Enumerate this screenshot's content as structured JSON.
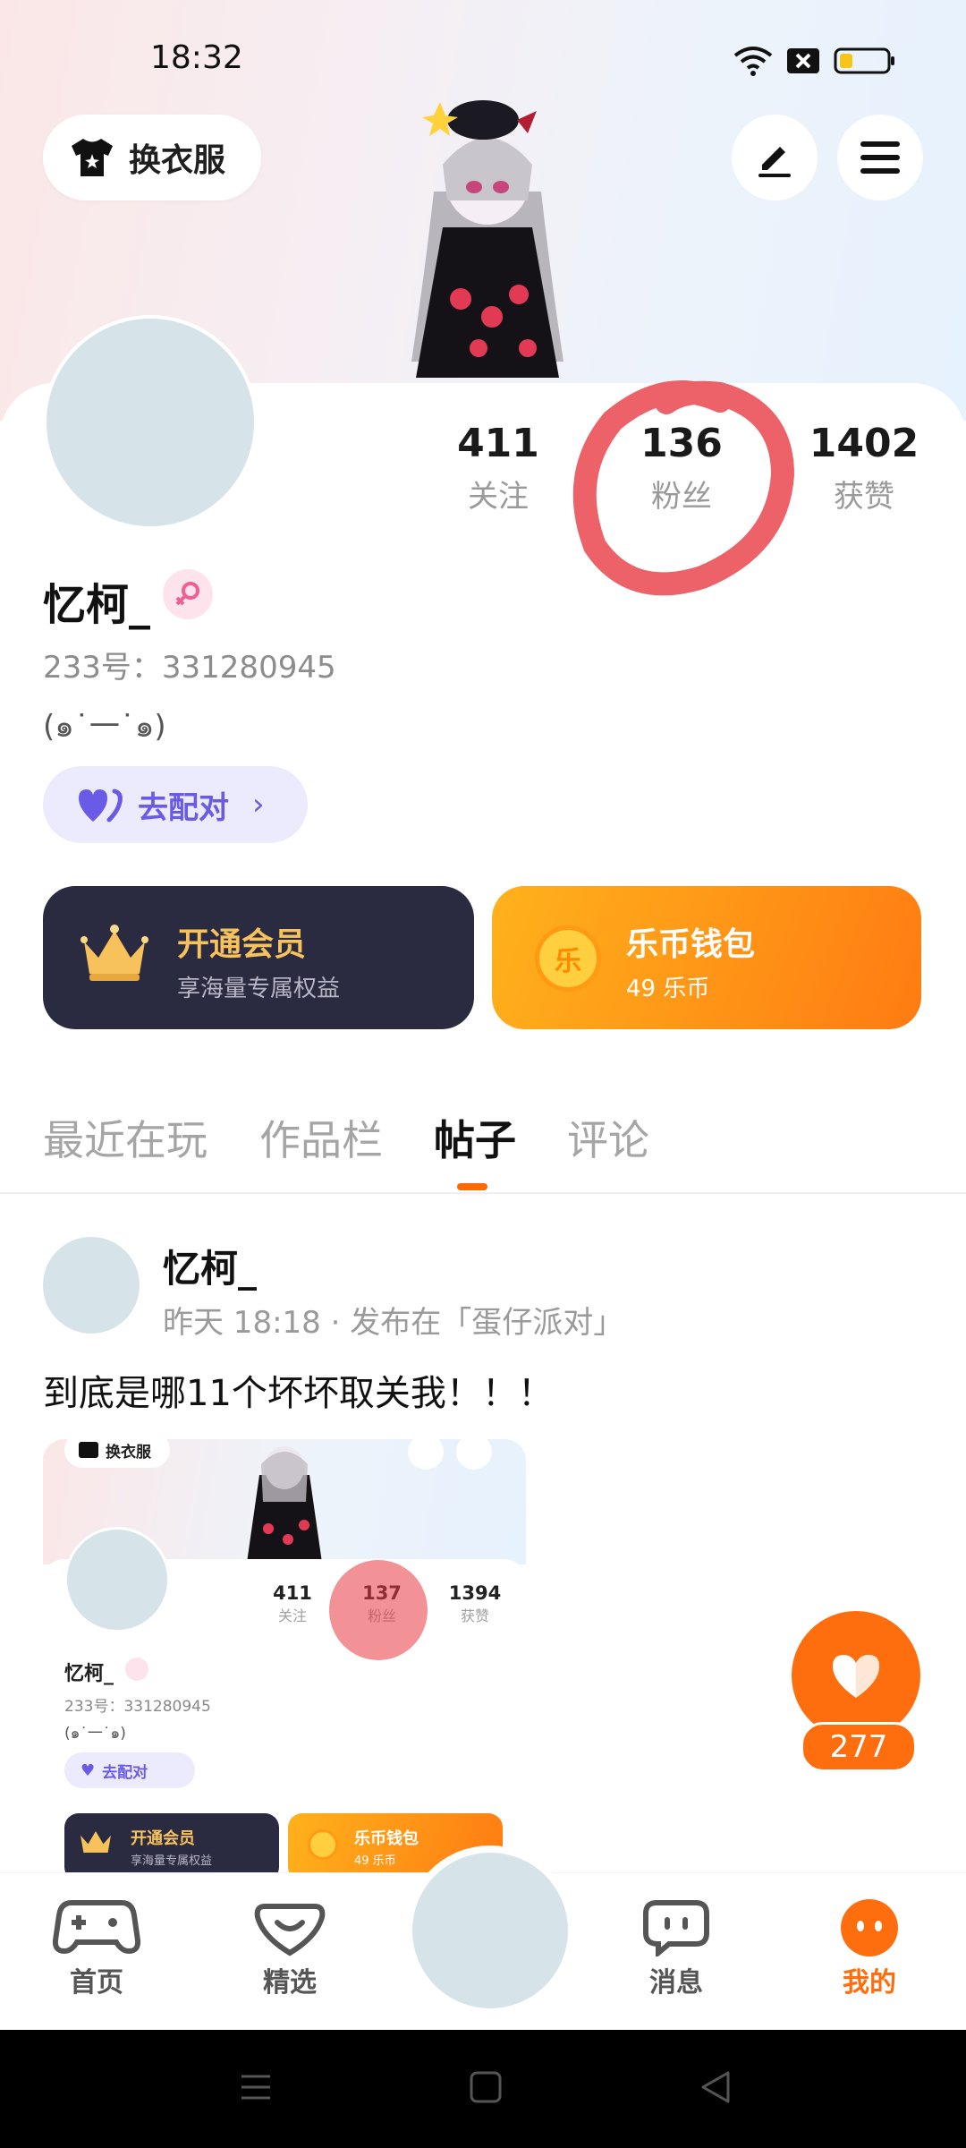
{
  "status_bar": {
    "time": "18:32"
  },
  "top_bar": {
    "outfit_button_label": "换衣服",
    "edit_icon": "pen-icon",
    "menu_icon": "menu-icon"
  },
  "profile": {
    "stats": [
      {
        "value": "411",
        "label": "关注"
      },
      {
        "value": "136",
        "label": "粉丝"
      },
      {
        "value": "1402",
        "label": "获赞"
      }
    ],
    "name": "忆柯_",
    "gender": "female",
    "uid_label": "233号",
    "uid_value": "331280945",
    "signature": "(๑˙一˙๑)",
    "match_button_label": "去配对"
  },
  "banners": {
    "vip": {
      "title": "开通会员",
      "subtitle": "享海量专属权益"
    },
    "wallet": {
      "title": "乐币钱包",
      "subtitle": "49 乐币",
      "coin_glyph": "乐"
    }
  },
  "tabs": [
    "最近在玩",
    "作品栏",
    "帖子",
    "评论"
  ],
  "active_tab": "帖子",
  "post": {
    "author": "忆柯_",
    "meta": "昨天 18:18 · 发布在「蛋仔派对」",
    "text": "到底是哪11个坏坏取关我！！！",
    "like_count": "277",
    "thumbnail": {
      "outfit_button_label": "换衣服",
      "stats": [
        {
          "value": "411",
          "label": "关注"
        },
        {
          "value": "137",
          "label": "粉丝"
        },
        {
          "value": "1394",
          "label": "获赞"
        }
      ],
      "name": "忆柯_",
      "uid": "233号：331280945",
      "signature": "(๑˙一˙๑)",
      "match_label": "去配对",
      "vip_title": "开通会员",
      "vip_subtitle": "享海量专属权益",
      "wallet_title": "乐币钱包",
      "wallet_subtitle": "49 乐币"
    }
  },
  "bottom_nav": [
    {
      "label": "首页",
      "icon": "gamepad-icon"
    },
    {
      "label": "精选",
      "icon": "heart-shield-icon"
    },
    {
      "label": "",
      "icon": "avatar"
    },
    {
      "label": "消息",
      "icon": "chat-icon"
    },
    {
      "label": "我的",
      "icon": "face-icon"
    }
  ],
  "colors": {
    "accent": "#ff6e0e",
    "match_purple": "#6a5be6",
    "vip_dark": "#2a2a40",
    "vip_gold": "#f7c25c"
  }
}
